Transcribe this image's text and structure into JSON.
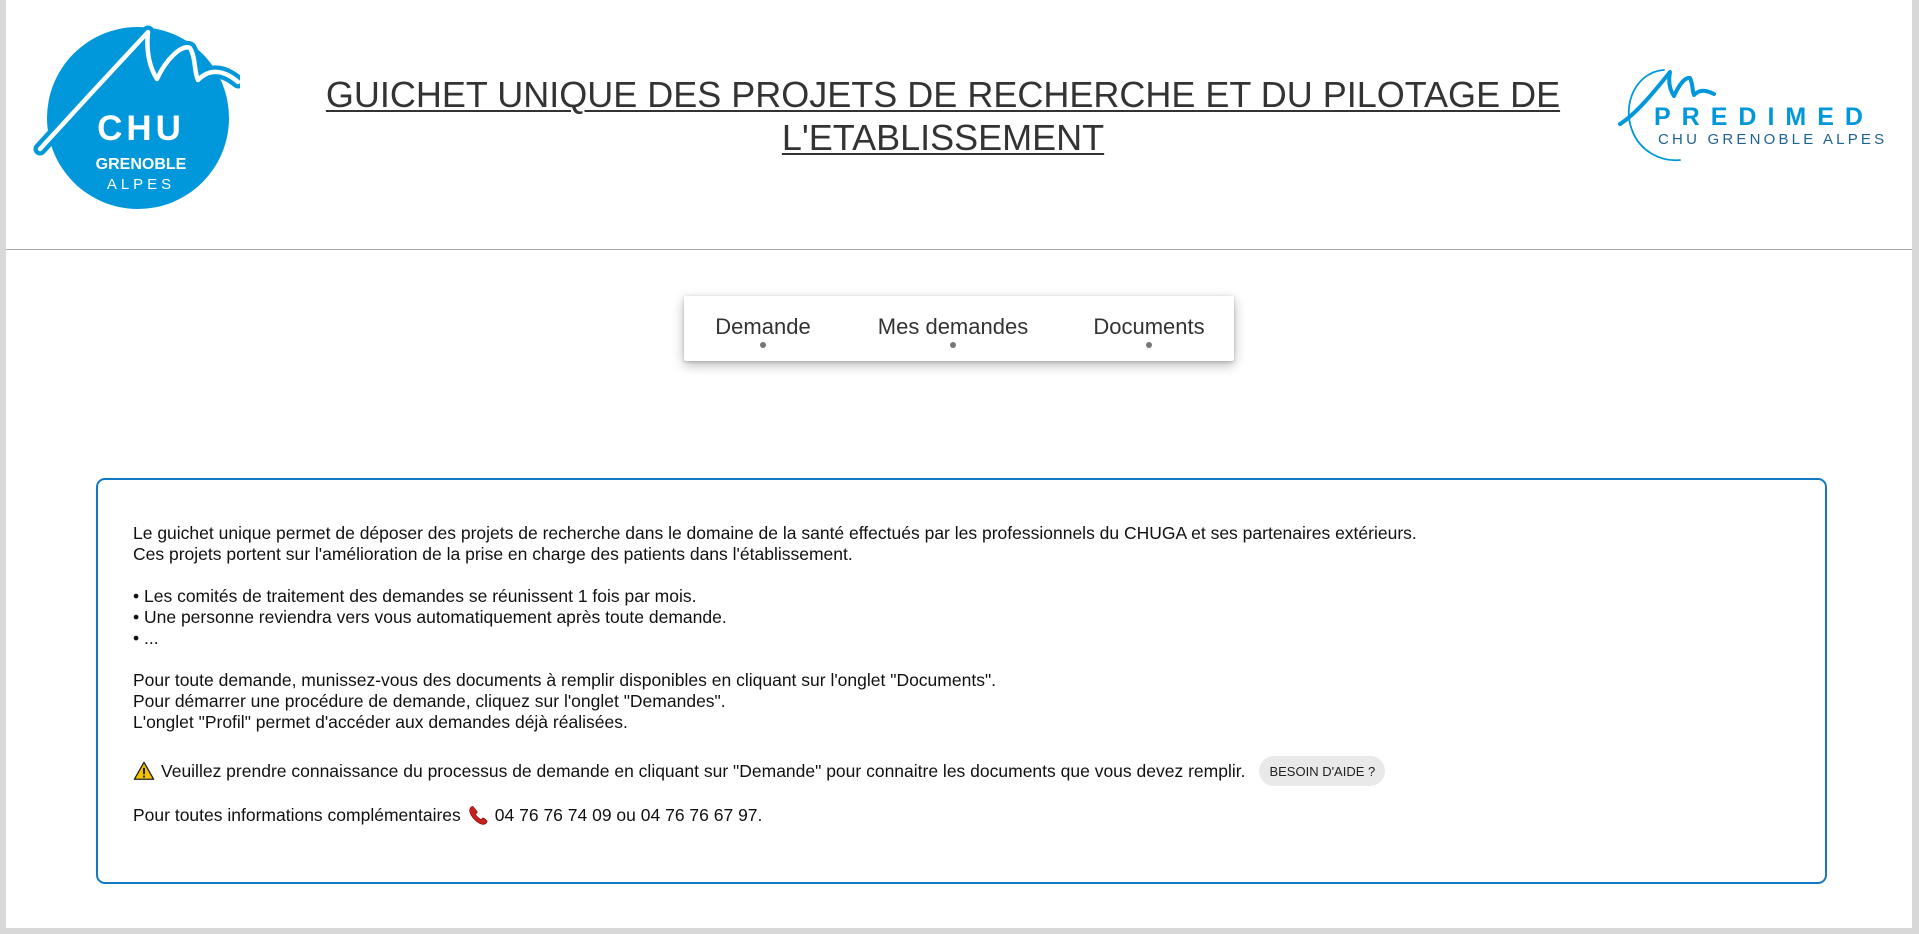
{
  "header": {
    "title": "GUICHET UNIQUE DES PROJETS DE RECHERCHE ET DU PILOTAGE DE L'ETABLISSEMENT",
    "logo_left": {
      "line1": "CHU",
      "line2": "GRENOBLE",
      "line3": "ALPES"
    },
    "logo_right": {
      "line1": "PREDIMED",
      "line2": "CHU GRENOBLE ALPES"
    }
  },
  "tabs": [
    {
      "label": "Demande"
    },
    {
      "label": "Mes demandes"
    },
    {
      "label": "Documents"
    }
  ],
  "info": {
    "intro1": "Le guichet unique permet de déposer des projets de recherche dans le domaine de la santé effectués par les professionnels du CHUGA et ses partenaires extérieurs.",
    "intro2": "Ces projets portent sur l'amélioration de la prise en charge des patients dans l'établissement.",
    "bullet1": "• Les comités de traitement des demandes se réunissent 1 fois par mois.",
    "bullet2": "• Une personne reviendra vers vous automatiquement après toute demande.",
    "bullet3": "• ...",
    "step1": "Pour toute demande, munissez-vous des documents à remplir disponibles en cliquant sur l'onglet \"Documents\".",
    "step2": "Pour démarrer une procédure de demande, cliquez sur l'onglet \"Demandes\".",
    "step3": "L'onglet \"Profil\" permet d'accéder aux demandes déjà réalisées.",
    "warning_text": "Veuillez prendre connaissance du processus de demande en cliquant sur \"Demande\" pour connaitre les documents que vous devez remplir.",
    "help_button": "BESOIN D'AIDE ?",
    "contact_prefix": "Pour toutes informations complémentaires",
    "contact_phones": "04 76 76 74 09 ou 04 76 76 67 97."
  },
  "colors": {
    "accent": "#1479c4",
    "chu_blue": "#0098db",
    "predimed_blue": "#0098db",
    "warning": "#f3c300",
    "phone": "#c9201c"
  },
  "icons": {
    "warning": "warning-icon",
    "phone": "phone-icon"
  }
}
